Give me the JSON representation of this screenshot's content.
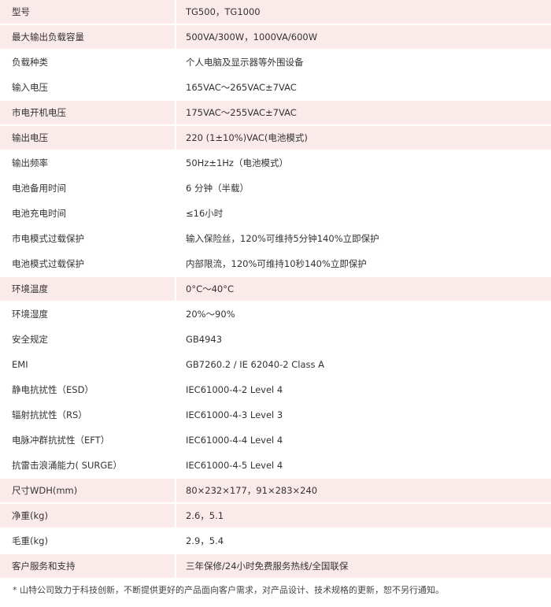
{
  "colors": {
    "row_pink": "#fbeaea",
    "row_white": "#ffffff"
  },
  "rows": [
    {
      "label": "型号",
      "value": "TG500，TG1000",
      "shade": "pink"
    },
    {
      "label": "最大输出负载容量",
      "value": "500VA/300W，1000VA/600W",
      "shade": "pink"
    },
    {
      "label": "负载种类",
      "value": "个人电脑及显示器等外围设备",
      "shade": "white"
    },
    {
      "label": "输入电压",
      "value": "165VAC～265VAC±7VAC",
      "shade": "white"
    },
    {
      "label": "市电开机电压",
      "value": "175VAC～255VAC±7VAC",
      "shade": "pink"
    },
    {
      "label": "输出电压",
      "value": "220 (1±10%)VAC(电池模式)",
      "shade": "pink"
    },
    {
      "label": "输出频率",
      "value": "50Hz±1Hz（电池模式）",
      "shade": "white"
    },
    {
      "label": "电池备用时间",
      "value": "6 分钟（半载）",
      "shade": "white"
    },
    {
      "label": "电池充电时间",
      "value": "≤16小时",
      "shade": "white"
    },
    {
      "label": "市电模式过载保护",
      "value": "输入保险丝，120%可维持5分钟140%立即保护",
      "shade": "white"
    },
    {
      "label": "电池模式过载保护",
      "value": "内部限流，120%可维持10秒140%立即保护",
      "shade": "white"
    },
    {
      "label": "环境温度",
      "value": "0°C～40°C",
      "shade": "pink"
    },
    {
      "label": "环境湿度",
      "value": "20%～90%",
      "shade": "white"
    },
    {
      "label": "安全规定",
      "value": "GB4943",
      "shade": "white"
    },
    {
      "label": "EMI",
      "value": "GB7260.2 / IE 62040-2 Class A",
      "shade": "white"
    },
    {
      "label": "静电抗扰性（ESD）",
      "value": "IEC61000-4-2 Level 4",
      "shade": "white"
    },
    {
      "label": "辐射抗扰性（RS）",
      "value": "IEC61000-4-3 Level 3",
      "shade": "white"
    },
    {
      "label": "电脉冲群抗扰性（EFT）",
      "value": "IEC61000-4-4 Level 4",
      "shade": "white"
    },
    {
      "label": "抗雷击浪涌能力( SURGE）",
      "value": "IEC61000-4-5 Level 4",
      "shade": "white"
    },
    {
      "label": "尺寸WDH(mm)",
      "value": "80×232×177，91×283×240",
      "shade": "pink"
    },
    {
      "label": "净重(kg)",
      "value": "2.6，5.1",
      "shade": "pink"
    },
    {
      "label": "毛重(kg)",
      "value": "2.9，5.4",
      "shade": "white"
    },
    {
      "label": "客户服务和支持",
      "value": "三年保修/24小时免费服务热线/全国联保",
      "shade": "pink"
    }
  ],
  "footnote": "* 山特公司致力于科技创新，不断提供更好的产品面向客户需求，对产品设计、技术规格的更新，恕不另行通知。"
}
